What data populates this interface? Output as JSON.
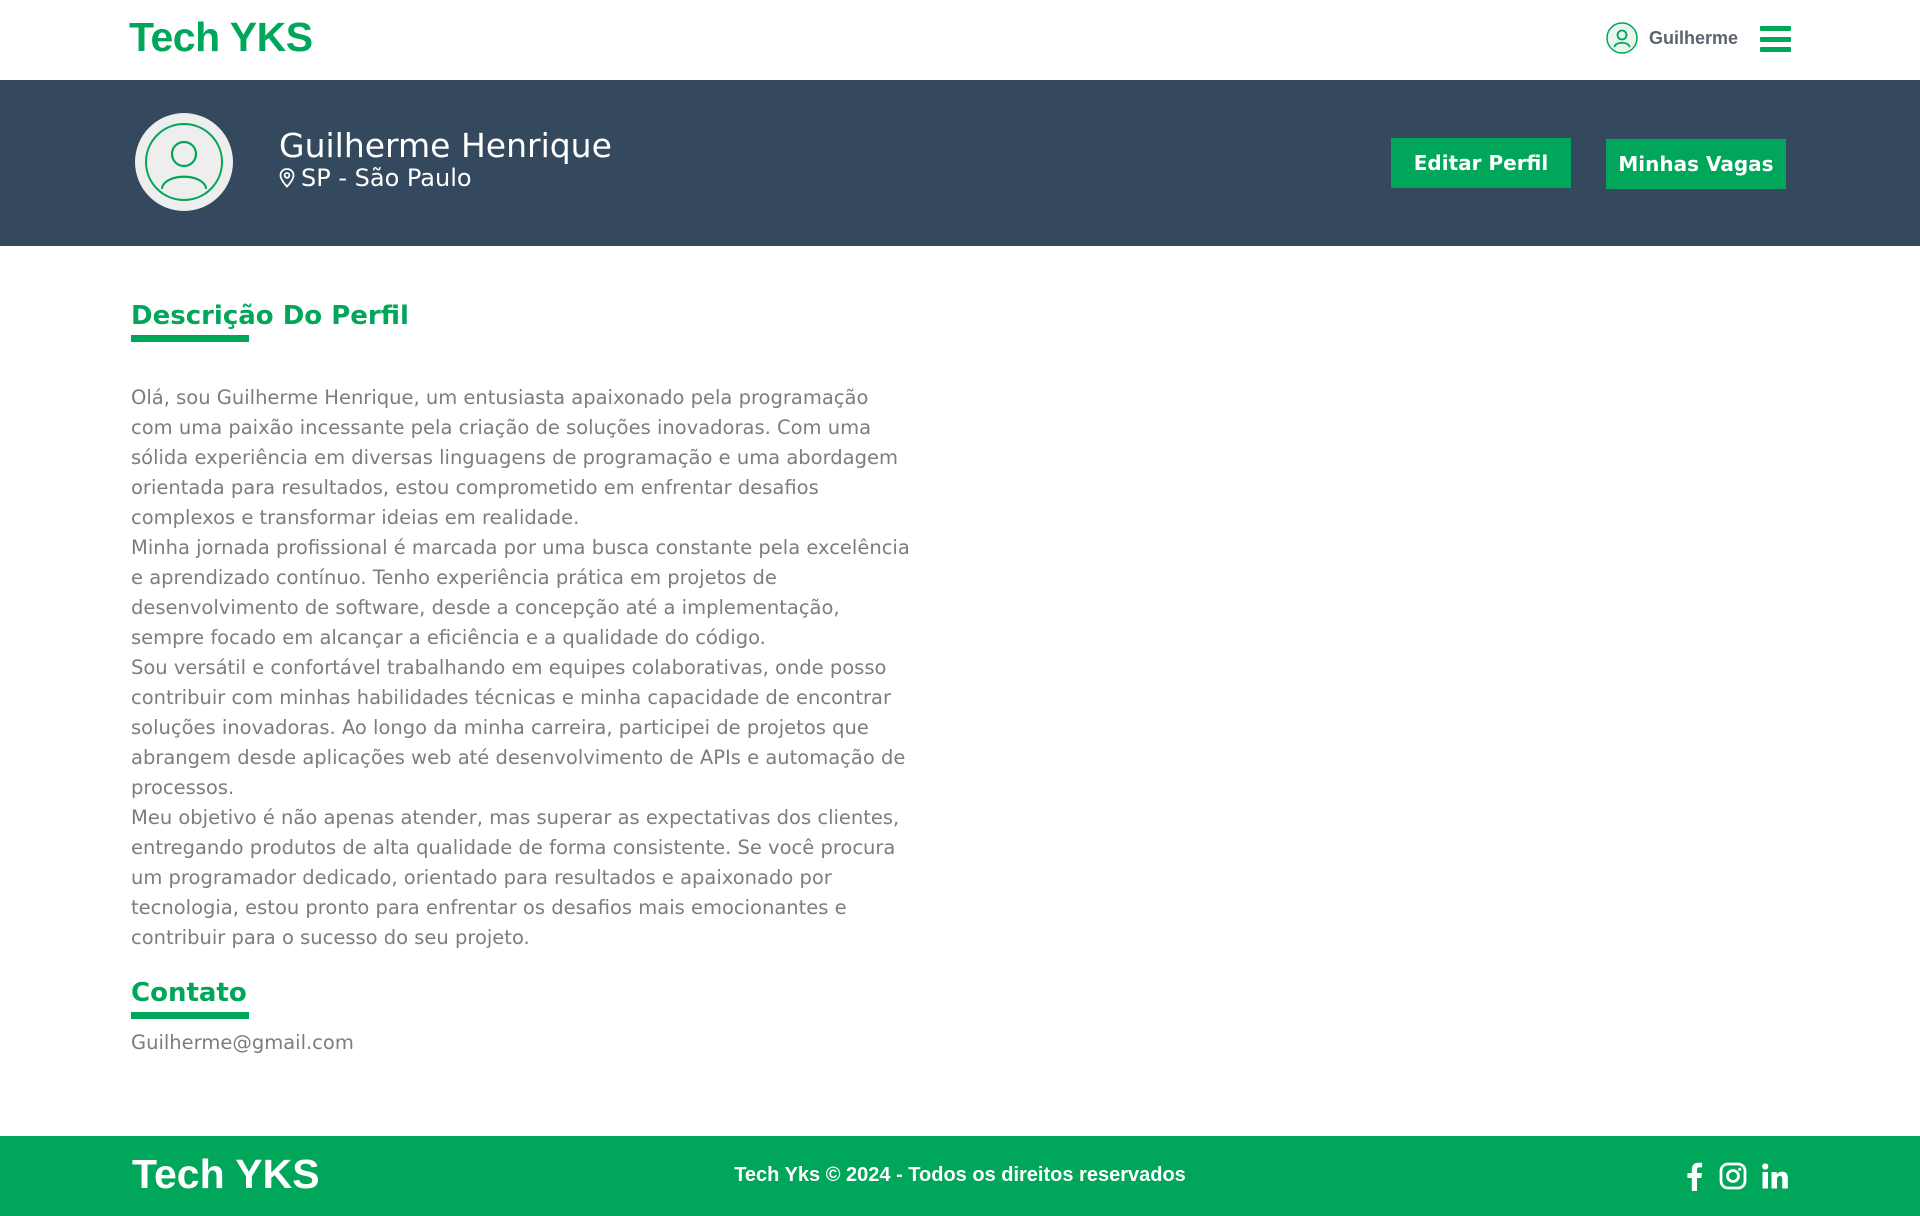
{
  "header": {
    "logo": "Tech YKS",
    "user_name": "Guilherme",
    "icons": {
      "user": "user-circle-icon",
      "menu": "hamburger-menu-icon"
    }
  },
  "profile": {
    "name": "Guilherme Henrique",
    "location": "SP - São Paulo",
    "edit_button": "Editar Perfil",
    "jobs_button": "Minhas Vagas",
    "icons": {
      "avatar": "user-avatar-icon",
      "location": "map-pin-icon"
    }
  },
  "description": {
    "title": "Descrição Do Perfil",
    "paragraphs": [
      "Olá, sou Guilherme Henrique, um entusiasta apaixonado pela programação com uma paixão incessante pela criação de soluções inovadoras. Com uma sólida experiência em diversas linguagens de programação e uma abordagem orientada para resultados, estou comprometido em enfrentar desafios complexos e transformar ideias em realidade.",
      "Minha jornada profissional é marcada por uma busca constante pela excelência e aprendizado contínuo. Tenho experiência prática em projetos de desenvolvimento de software, desde a concepção até a implementação, sempre focado em alcançar a eficiência e a qualidade do código.",
      "Sou versátil e confortável trabalhando em equipes colaborativas, onde posso contribuir com minhas habilidades técnicas e minha capacidade de encontrar soluções inovadoras. Ao longo da minha carreira, participei de projetos que abrangem desde aplicações web até desenvolvimento de APIs e automação de processos.",
      "Meu objetivo é não apenas atender, mas superar as expectativas dos clientes, entregando produtos de alta qualidade de forma consistente. Se você procura um programador dedicado, orientado para resultados e apaixonado por tecnologia, estou pronto para enfrentar os desafios mais emocionantes e contribuir para o sucesso do seu projeto."
    ]
  },
  "contact": {
    "title": "Contato",
    "email": "Guilherme@gmail.com"
  },
  "footer": {
    "logo": "Tech YKS",
    "copyright": "Tech Yks © 2024 - Todos os direitos reservados",
    "icons": [
      "facebook-icon",
      "instagram-icon",
      "linkedin-icon"
    ]
  },
  "colors": {
    "brand_green": "#00a65a",
    "header_navy": "#34495e",
    "body_text": "#7d7d7d"
  }
}
